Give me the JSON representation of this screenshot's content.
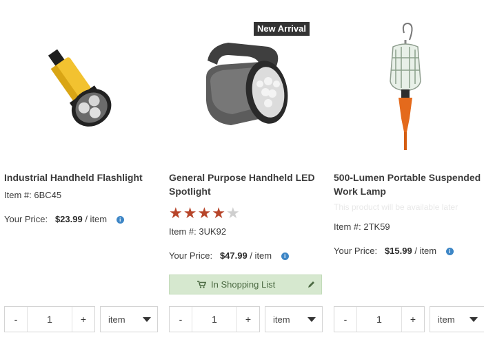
{
  "products": [
    {
      "title": "Industrial Handheld Flashlight",
      "item_no": "Item #: 6BC45",
      "price_label": "Your Price:",
      "price": "$23.99",
      "per": " / item",
      "qty": "1",
      "unit": "item",
      "minus": "-",
      "plus": "+"
    },
    {
      "badge": "New Arrival",
      "title": "General Purpose Handheld LED Spotlight",
      "rating": 4,
      "rating_max": 5,
      "item_no": "Item #: 3UK92",
      "price_label": "Your Price:",
      "price": "$47.99",
      "per": " / item",
      "shopping_list": "In Shopping List",
      "qty": "1",
      "unit": "item",
      "minus": "-",
      "plus": "+"
    },
    {
      "title": "500-Lumen Portable Suspended Work Lamp",
      "availability": "This product will be available later",
      "item_no": "Item #: 2TK59",
      "price_label": "Your Price:",
      "price": "$15.99",
      "per": " / item",
      "qty": "1",
      "unit": "item",
      "minus": "-",
      "plus": "+"
    }
  ],
  "colors": {
    "star_on": "#b7452a",
    "star_off": "#cfcfcf",
    "shopping_bg": "#d6e8cf",
    "info": "#3d86c6"
  }
}
